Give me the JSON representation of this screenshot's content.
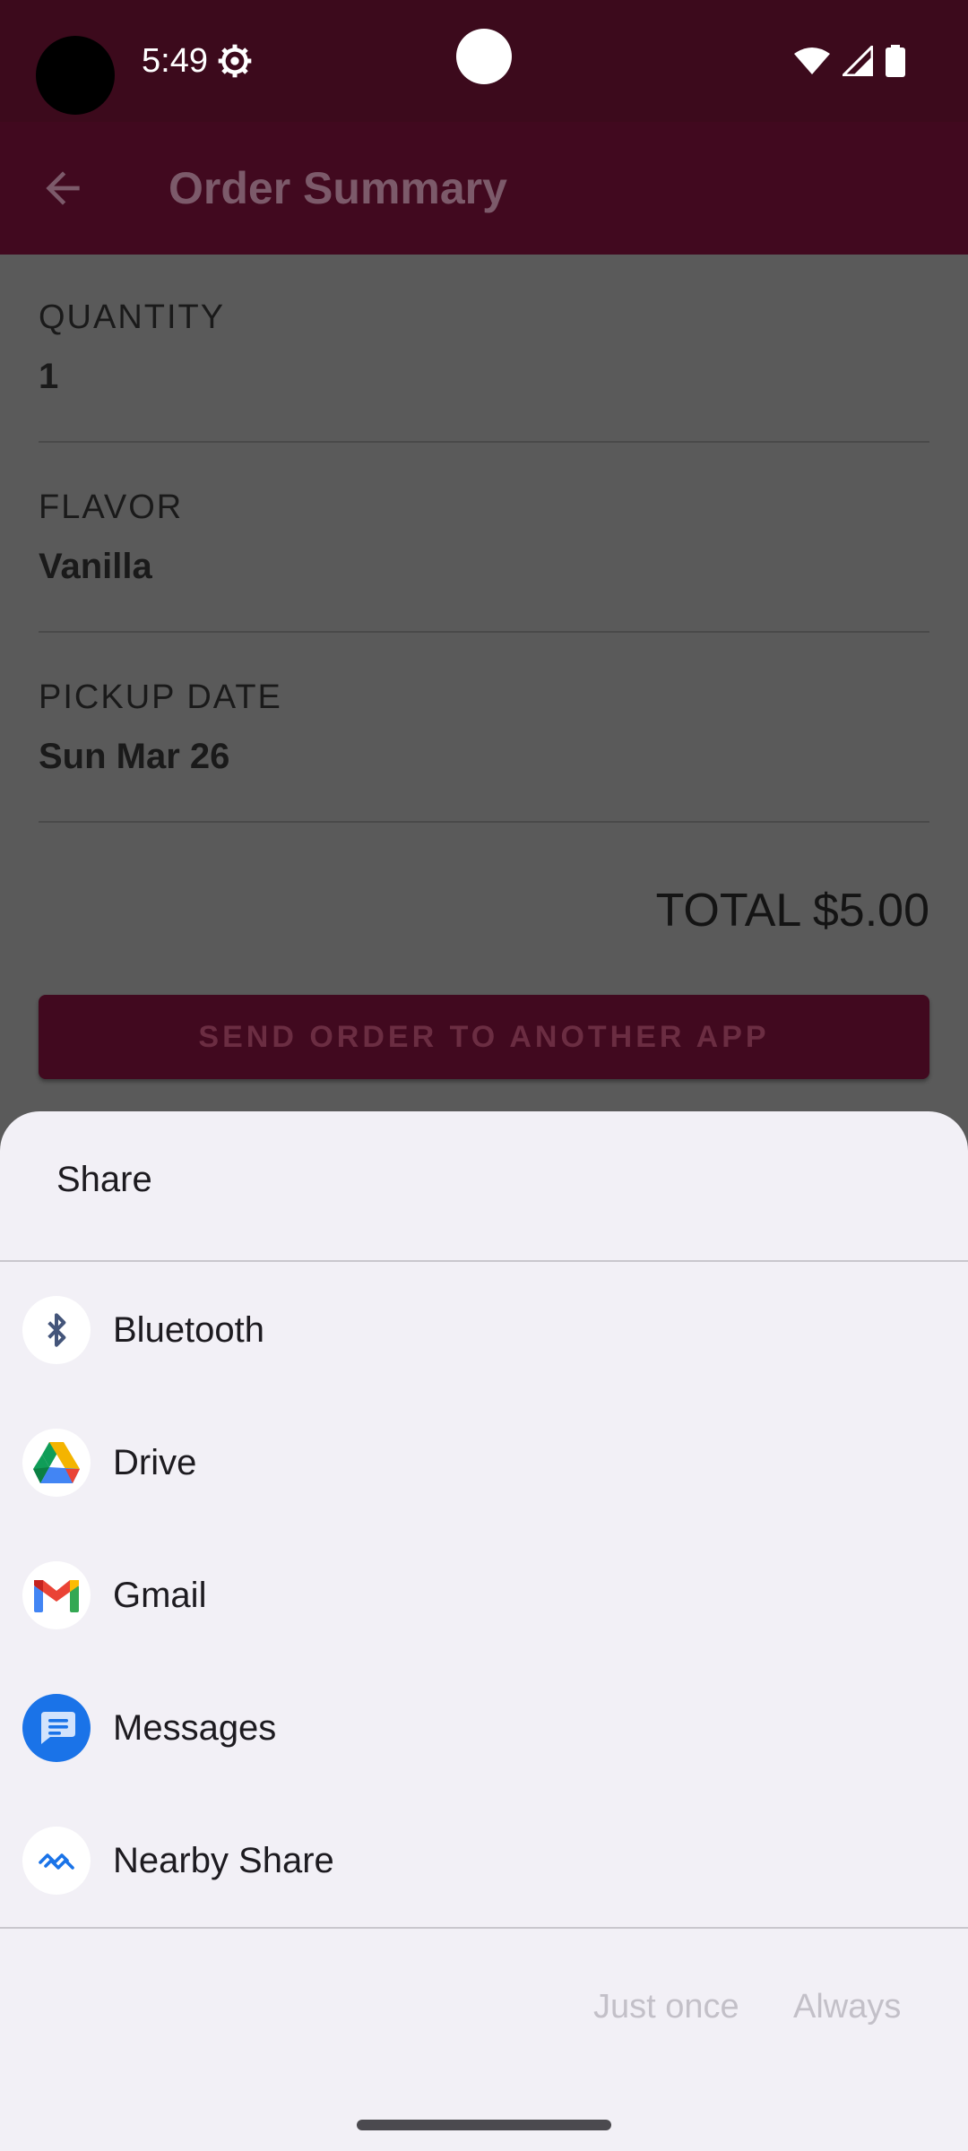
{
  "status_bar": {
    "time": "5:49"
  },
  "app_bar": {
    "title": "Order Summary"
  },
  "order": {
    "quantity_label": "QUANTITY",
    "quantity_value": "1",
    "flavor_label": "FLAVOR",
    "flavor_value": "Vanilla",
    "pickup_label": "PICKUP DATE",
    "pickup_value": "Sun Mar 26",
    "total": "TOTAL $5.00",
    "send_button": "SEND ORDER TO ANOTHER APP"
  },
  "share_sheet": {
    "title": "Share",
    "apps": [
      {
        "label": "Bluetooth",
        "icon": "bluetooth-icon"
      },
      {
        "label": "Drive",
        "icon": "drive-icon"
      },
      {
        "label": "Gmail",
        "icon": "gmail-icon"
      },
      {
        "label": "Messages",
        "icon": "messages-icon"
      },
      {
        "label": "Nearby Share",
        "icon": "nearby-share-icon"
      }
    ],
    "just_once": "Just once",
    "always": "Always"
  },
  "colors": {
    "status_bar": "#3c0a1c",
    "app_bar": "#41091f",
    "scrim_content": "#5a5a5a",
    "sheet_background": "#f2f0f6"
  }
}
